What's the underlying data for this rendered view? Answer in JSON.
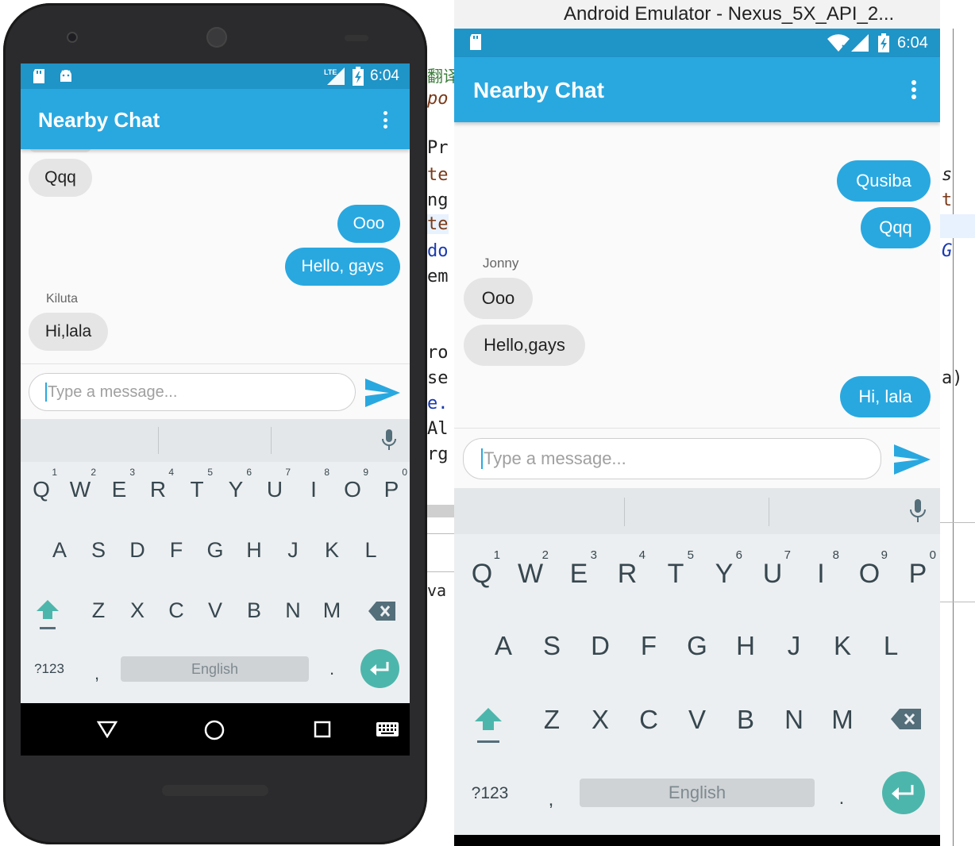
{
  "emulator": {
    "window_title": "Android Emulator - Nexus_5X_API_2..."
  },
  "ide": {
    "left_fragments": [
      "翻译",
      "po",
      "Pr",
      "te",
      "ng",
      "te",
      "do",
      "em",
      "ro",
      "se",
      "e.",
      "Al",
      "rg",
      "va"
    ],
    "right_fragments": [
      "s",
      "t",
      "G",
      "a)"
    ]
  },
  "device_a": {
    "status": {
      "time": "6:04",
      "network": "LTE"
    },
    "app_title": "Nearby Chat",
    "messages": [
      {
        "text": "Qqq",
        "dir": "in",
        "sender": ""
      },
      {
        "text": "Ooo",
        "dir": "out",
        "sender": ""
      },
      {
        "text": "Hello, gays",
        "dir": "out",
        "sender": ""
      },
      {
        "text": "Hi,lala",
        "dir": "in",
        "sender": "Kiluta"
      }
    ],
    "composer": {
      "placeholder": "Type a message..."
    },
    "keyboard": {
      "row1": [
        "Q",
        "W",
        "E",
        "R",
        "T",
        "Y",
        "U",
        "I",
        "O",
        "P"
      ],
      "row1_nums": [
        "1",
        "2",
        "3",
        "4",
        "5",
        "6",
        "7",
        "8",
        "9",
        "0"
      ],
      "row2": [
        "A",
        "S",
        "D",
        "F",
        "G",
        "H",
        "J",
        "K",
        "L"
      ],
      "row3": [
        "Z",
        "X",
        "C",
        "V",
        "B",
        "N",
        "M"
      ],
      "symbols": "?123",
      "comma": ",",
      "space": "English",
      "period": "."
    }
  },
  "device_b": {
    "status": {
      "time": "6:04"
    },
    "app_title": "Nearby Chat",
    "messages": [
      {
        "text": "Qusiba",
        "dir": "out",
        "sender": ""
      },
      {
        "text": "Qqq",
        "dir": "out",
        "sender": ""
      },
      {
        "text": "Ooo",
        "dir": "in",
        "sender": "Jonny"
      },
      {
        "text": "Hello,gays",
        "dir": "in",
        "sender": ""
      },
      {
        "text": "Hi, lala",
        "dir": "out",
        "sender": ""
      }
    ],
    "composer": {
      "placeholder": "Type a message..."
    },
    "keyboard": {
      "row1": [
        "Q",
        "W",
        "E",
        "R",
        "T",
        "Y",
        "U",
        "I",
        "O",
        "P"
      ],
      "row1_nums": [
        "1",
        "2",
        "3",
        "4",
        "5",
        "6",
        "7",
        "8",
        "9",
        "0"
      ],
      "row2": [
        "A",
        "S",
        "D",
        "F",
        "G",
        "H",
        "J",
        "K",
        "L"
      ],
      "row3": [
        "Z",
        "X",
        "C",
        "V",
        "B",
        "N",
        "M"
      ],
      "symbols": "?123",
      "comma": ",",
      "space": "English",
      "period": "."
    }
  },
  "colors": {
    "app_bar": "#29a8e0",
    "status_bar": "#1f94c7",
    "outgoing_bubble": "#29a8e0",
    "incoming_bubble": "#e5e5e5",
    "enter_key": "#4db6ac"
  },
  "icons": [
    "sd-card-icon",
    "android-icon",
    "lte-signal-icon",
    "wifi-icon",
    "cell-signal-icon",
    "battery-charging-icon",
    "overflow-menu-icon",
    "send-icon",
    "microphone-icon",
    "shift-icon",
    "backspace-icon",
    "enter-icon",
    "back-nav-icon",
    "home-nav-icon",
    "recents-nav-icon",
    "keyboard-switch-icon"
  ]
}
